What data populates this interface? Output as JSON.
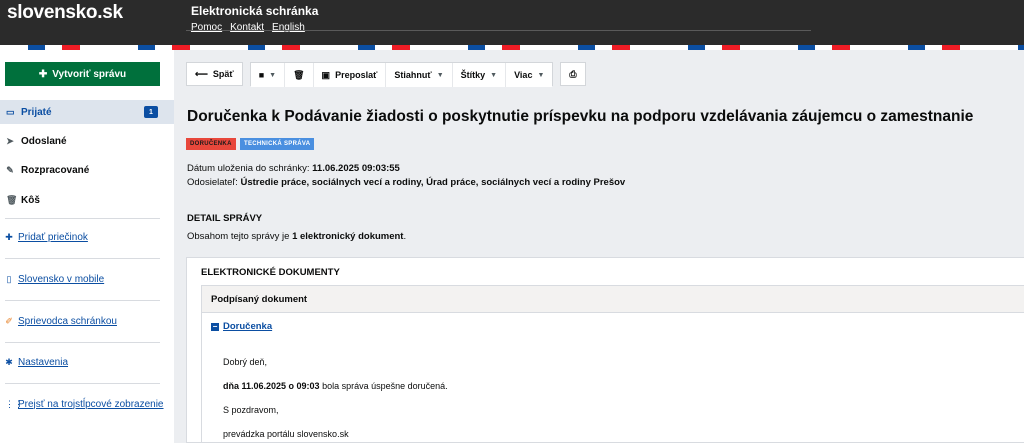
{
  "header": {
    "logo": "slovensko.sk",
    "app_title": "Elektronická schránka",
    "links": [
      "Pomoc",
      "Kontakt",
      "English"
    ]
  },
  "sidebar": {
    "create_label": "Vytvoriť správu",
    "folders": [
      {
        "label": "Prijaté",
        "icon": "inbox-icon",
        "badge": "1",
        "active": true
      },
      {
        "label": "Odoslané",
        "icon": "paper-plane-icon"
      },
      {
        "label": "Rozpracované",
        "icon": "pencil-icon"
      },
      {
        "label": "Kôš",
        "icon": "trash-icon"
      }
    ],
    "links": [
      {
        "label": "Pridať priečinok",
        "icon": "plus-icon"
      },
      {
        "label": "Slovensko v mobile",
        "icon": "mobile-icon"
      },
      {
        "label": "Sprievodca schránkou",
        "icon": "wand-icon"
      },
      {
        "label": "Nastavenia",
        "icon": "gear-icon"
      },
      {
        "label": "Prejsť na trojstĺpcové zobrazenie",
        "icon": "columns-icon"
      }
    ]
  },
  "toolbar": {
    "back": "Späť",
    "forward": "Preposlať",
    "download": "Stiahnuť",
    "labels": "Štítky",
    "more": "Viac"
  },
  "message": {
    "subject": "Doručenka k Podávanie žiadosti o poskytnutie príspevku na podporu vzdelávania záujemcu o zamestnanie",
    "tags": [
      "DORUČENKA",
      "TECHNICKÁ SPRÁVA"
    ],
    "saved_label": "Dátum uloženia do schránky:",
    "saved_value": "11.06.2025 09:03:55",
    "sender_label": "Odosielateľ:",
    "sender_value": "Ústredie práce, sociálnych vecí a rodiny, Úrad práce, sociálnych vecí a rodiny Prešov",
    "detail_title": "DETAIL SPRÁVY",
    "detail_prefix": "Obsahom tejto správy je",
    "detail_bold": "1 elektronický dokument",
    "detail_suffix": "."
  },
  "documents": {
    "title": "ELEKTRONICKÉ DOKUMENTY",
    "signed_title": "Podpísaný dokument",
    "doc_name": "Doručenka",
    "greeting": "Dobrý deň,",
    "line_bold": "dňa 11.06.2025 o 09:03",
    "line_rest": "bola správa úspešne doručená.",
    "regards": "S pozdravom,",
    "signature": "prevádzka portálu slovensko.sk"
  }
}
